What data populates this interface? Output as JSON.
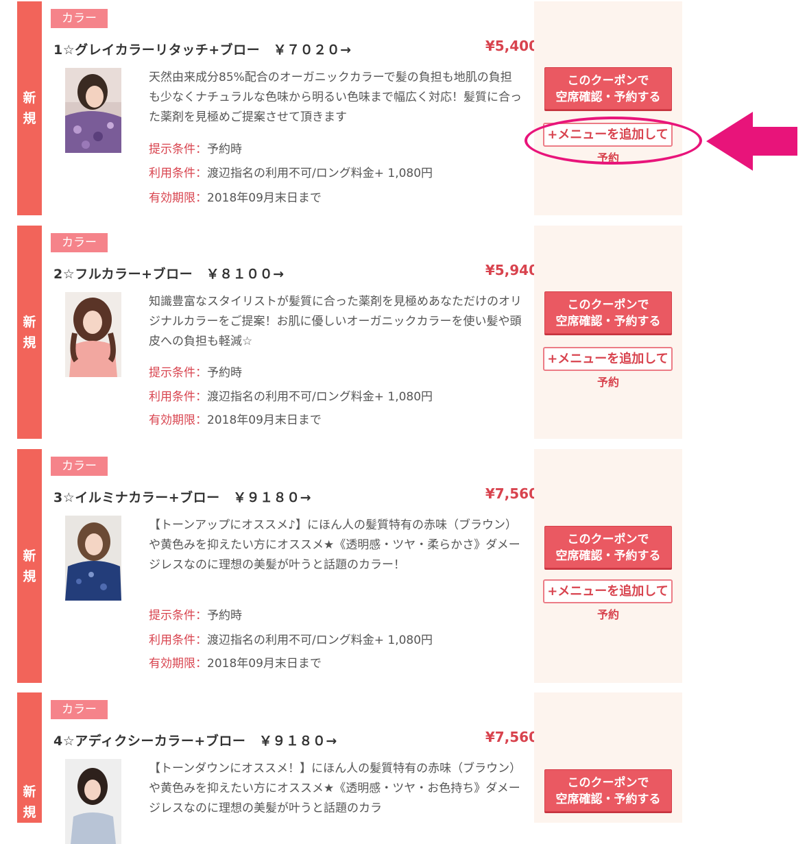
{
  "coupons": [
    {
      "side_label_1": "新",
      "side_label_2": "規",
      "category": "カラー",
      "title": "1☆グレイカラーリタッチ+ブロー　￥７０２０→",
      "price": "¥5,400",
      "description": "天然由来成分85%配合のオーガニックカラーで髪の負担も地肌の負担も少なくナチュラルな色味から明るい色味まで幅広く対応！髪質に合った薬剤を見極めご提案させて頂きます",
      "cond1_key": "提示条件：",
      "cond1_val": "予約時",
      "cond2_key": "利用条件：",
      "cond2_val": "渡辺指名の利用不可/ロング料金+ 1,080円",
      "cond3_key": "有効期限：",
      "cond3_val": "2018年09月末日まで",
      "btn_main_1": "このクーポンで",
      "btn_main_2": "空席確認・予約する",
      "btn_add": "+メニューを追加して",
      "btn_add_sub": "予約"
    },
    {
      "side_label_1": "新",
      "side_label_2": "規",
      "category": "カラー",
      "title": "2☆フルカラー+ブロー　￥８１００→",
      "price": "¥5,940",
      "description": "知識豊富なスタイリストが髪質に合った薬剤を見極めあなただけのオリジナルカラーをご提案！お肌に優しいオーガニックカラーを使い髪や頭皮への負担も軽減☆",
      "cond1_key": "提示条件：",
      "cond1_val": "予約時",
      "cond2_key": "利用条件：",
      "cond2_val": "渡辺指名の利用不可/ロング料金+ 1,080円",
      "cond3_key": "有効期限：",
      "cond3_val": "2018年09月末日まで",
      "btn_main_1": "このクーポンで",
      "btn_main_2": "空席確認・予約する",
      "btn_add": "+メニューを追加して",
      "btn_add_sub": "予約"
    },
    {
      "side_label_1": "新",
      "side_label_2": "規",
      "category": "カラー",
      "title": "3☆イルミナカラー+ブロー　￥９１８０→",
      "price": "¥7,560",
      "description": "【トーンアップにオススメ♪】にほん人の髪質特有の赤味（ブラウン）や黄色みを抑えたい方にオススメ★《透明感・ツヤ・柔らかさ》ダメージレスなのに理想の美髪が叶うと話題のカラー！",
      "cond1_key": "提示条件：",
      "cond1_val": "予約時",
      "cond2_key": "利用条件：",
      "cond2_val": "渡辺指名の利用不可/ロング料金+ 1,080円",
      "cond3_key": "有効期限：",
      "cond3_val": "2018年09月末日まで",
      "btn_main_1": "このクーポンで",
      "btn_main_2": "空席確認・予約する",
      "btn_add": "+メニューを追加して",
      "btn_add_sub": "予約"
    },
    {
      "side_label_1": "新",
      "side_label_2": "規",
      "category": "カラー",
      "title": "4☆アディクシーカラー+ブロー　￥９１８０→",
      "price": "¥7,560",
      "description": "【トーンダウンにオススメ！】にほん人の髪質特有の赤味（ブラウン）や黄色みを抑えたい方にオススメ★《透明感・ツヤ・お色持ち》ダメージレスなのに理想の美髪が叶うと話題のカラ",
      "btn_main_1": "このクーポンで",
      "btn_main_2": "空席確認・予約する"
    }
  ],
  "colors": {
    "accent": "#f2645a",
    "price": "#d8434e",
    "button": "#ea5962",
    "action_bg": "#fdf4ee",
    "highlight": "#e8147a"
  }
}
